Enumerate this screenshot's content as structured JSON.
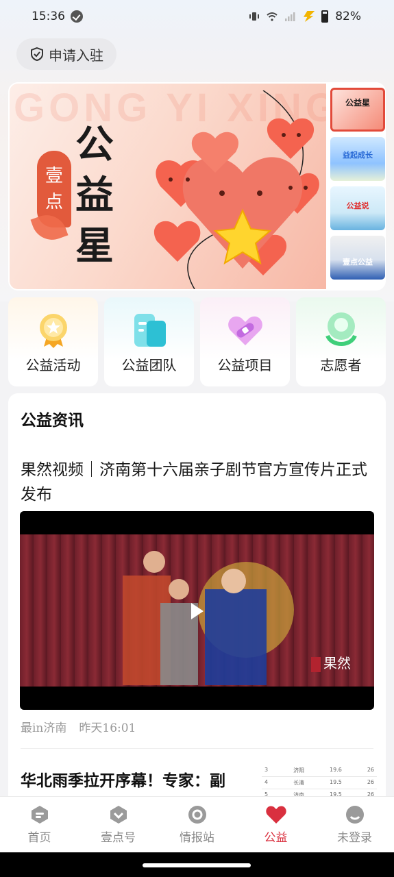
{
  "status": {
    "time": "15:36",
    "battery": "82%"
  },
  "apply_button": {
    "label": "申请入驻",
    "icon": "shield-check-icon"
  },
  "banner": {
    "bg_text": "GONG YI XING",
    "badge_line1": "壹",
    "badge_line2": "点",
    "title_chars": [
      "公",
      "益",
      "星"
    ],
    "thumbnails": [
      {
        "label": "公益星"
      },
      {
        "label": "益起成长"
      },
      {
        "label": "公益说"
      },
      {
        "label": "壹点公益"
      }
    ]
  },
  "quick_entries": [
    {
      "label": "公益活动",
      "icon": "medal-icon"
    },
    {
      "label": "公益团队",
      "icon": "team-cards-icon"
    },
    {
      "label": "公益项目",
      "icon": "heart-bandage-icon"
    },
    {
      "label": "志愿者",
      "icon": "volunteer-icon"
    }
  ],
  "news": {
    "heading": "公益资讯",
    "article1": {
      "title": "果然视频｜济南第十六届亲子剧节官方宣传片正式发布",
      "watermark": "果然",
      "source": "最in济南",
      "time": "昨天16:01"
    },
    "article2": {
      "title": "华北雨季拉开序幕！专家：副",
      "table_rows": [
        [
          "3",
          "济阳",
          "19.6",
          "26"
        ],
        [
          "4",
          "长清",
          "19.5",
          "26"
        ],
        [
          "5",
          "济南",
          "19.5",
          "26"
        ]
      ]
    }
  },
  "tabs": [
    {
      "label": "首页",
      "icon": "home-icon"
    },
    {
      "label": "壹点号",
      "icon": "heart-shield-icon"
    },
    {
      "label": "情报站",
      "icon": "radar-icon"
    },
    {
      "label": "公益",
      "icon": "heart-icon",
      "active": true
    },
    {
      "label": "未登录",
      "icon": "user-icon"
    }
  ],
  "colors": {
    "accent": "#d9303f",
    "banner_red": "#e25a3c"
  }
}
